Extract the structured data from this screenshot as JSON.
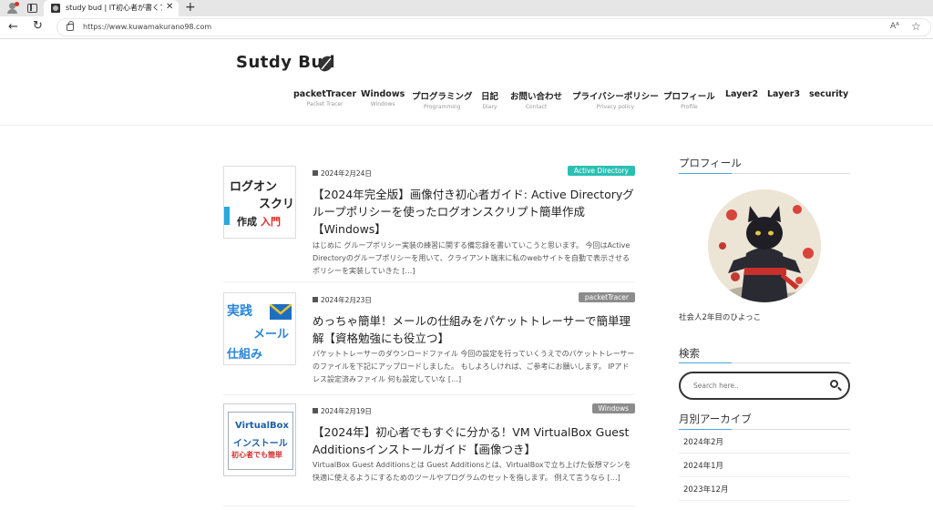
{
  "browser": {
    "tab_title": "study bud | IT初心者が書くブログ",
    "new_tab": "+",
    "url": "https://www.kuwamakurano98.com",
    "read_aloud": "Aᴬ"
  },
  "site": {
    "logo": "Sutdy Bud",
    "nav": [
      {
        "label": "packetTracer",
        "sub": "Packet Tracer"
      },
      {
        "label": "Windows",
        "sub": "Windows"
      },
      {
        "label": "プログラミング",
        "sub": "Programming"
      },
      {
        "label": "日記",
        "sub": "Diary"
      },
      {
        "label": "お問い合わせ",
        "sub": "Contact"
      },
      {
        "label": "プライバシーポリシー",
        "sub": "Privacy policy"
      },
      {
        "label": "プロフィール",
        "sub": "Profile"
      },
      {
        "label": "Layer2",
        "sub": ""
      },
      {
        "label": "Layer3",
        "sub": ""
      },
      {
        "label": "security",
        "sub": ""
      }
    ]
  },
  "posts": [
    {
      "date": "2024年2月24日",
      "category": "Active Directory",
      "category_color": "#2bbfb3",
      "title": "【2024年完全版】画像付き初心者ガイド: Active Directoryグループポリシーを使ったログオンスクリプト簡単作成【Windows】",
      "excerpt": "はじめに グループポリシー実装の練習に関する備忘録を書いていこうと思います。 今回はActive Directoryのグループポリシーを用いて、クライアント端末に私のwebサイトを自動で表示させるポリシーを実装していきた […]",
      "thumb": {
        "line1": "ログオン",
        "line2": "スクリ",
        "line3a": "作成",
        "line3b": "入門"
      }
    },
    {
      "date": "2024年2月23日",
      "category": "packetTracer",
      "category_color": "#8c8c8c",
      "title": "めっちゃ簡単！メールの仕組みをパケットトレーサーで簡単理解【資格勉強にも役立つ】",
      "excerpt": "パケットトレーサーのダウンロードファイル 今回の設定を行っていくうえでのパケットトレーサーのファイルを下記にアップロードしました。 もしよろしければ、ご参考にお願いします。 IPアドレス設定済みファイル 何も設定していな […]",
      "thumb": {
        "line1": "実践",
        "line2": "メール",
        "line3": "仕組み"
      }
    },
    {
      "date": "2024年2月19日",
      "category": "Windows",
      "category_color": "#8c8c8c",
      "title": "【2024年】初心者でもすぐに分かる！VM VirtualBox Guest Additionsインストールガイド【画像つき】",
      "excerpt": "VirtualBox Guest Additionsとは Guest Additionsとは、VirtualBoxで立ち上げた仮想マシンを快適に使えるようにするためのツールやプログラムのセットを指します。 例えて言うなら […]",
      "thumb": {
        "line1": "VirtualBox",
        "line2": "インストール",
        "line3": "初心者でも簡単"
      }
    }
  ],
  "sidebar": {
    "profile_heading": "プロフィール",
    "profile_text": "社会人2年目のひよっこ",
    "search_heading": "検索",
    "search_placeholder": "Search here..",
    "archive_heading": "月別アーカイブ",
    "archives": [
      "2024年2月",
      "2024年1月",
      "2023年12月"
    ]
  }
}
